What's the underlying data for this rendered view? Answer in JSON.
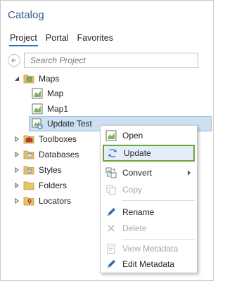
{
  "pane": {
    "title": "Catalog"
  },
  "tabs": [
    {
      "label": "Project",
      "active": true
    },
    {
      "label": "Portal",
      "active": false
    },
    {
      "label": "Favorites",
      "active": false
    }
  ],
  "search": {
    "placeholder": "Search Project"
  },
  "tree": {
    "maps": {
      "label": "Maps",
      "children": [
        {
          "label": "Map"
        },
        {
          "label": "Map1"
        },
        {
          "label": "Update Test",
          "selected": true
        }
      ]
    },
    "others": [
      {
        "label": "Toolboxes",
        "icon": "toolbox-folder-icon"
      },
      {
        "label": "Databases",
        "icon": "database-folder-icon"
      },
      {
        "label": "Styles",
        "icon": "styles-folder-icon"
      },
      {
        "label": "Folders",
        "icon": "folder-icon"
      },
      {
        "label": "Locators",
        "icon": "locator-folder-icon"
      }
    ]
  },
  "context_menu": {
    "items": [
      {
        "label": "Open",
        "icon": "open-map-icon",
        "enabled": true
      },
      {
        "label": "Update",
        "icon": "update-icon",
        "enabled": true,
        "highlighted": true
      },
      {
        "label": "Convert",
        "icon": "convert-icon",
        "enabled": true,
        "submenu": true
      },
      {
        "label": "Copy",
        "icon": "copy-icon",
        "enabled": false
      },
      {
        "label": "Rename",
        "icon": "rename-pencil-icon",
        "enabled": true
      },
      {
        "label": "Delete",
        "icon": "delete-x-icon",
        "enabled": false
      },
      {
        "label": "View Metadata",
        "icon": "view-metadata-icon",
        "enabled": false
      },
      {
        "label": "Edit Metadata",
        "icon": "edit-metadata-icon",
        "enabled": true
      }
    ]
  },
  "colors": {
    "title": "#2f5a8c",
    "selection_bg": "#cde0f2",
    "highlight_border": "#6aa337",
    "disabled_text": "#a8a8a8"
  }
}
